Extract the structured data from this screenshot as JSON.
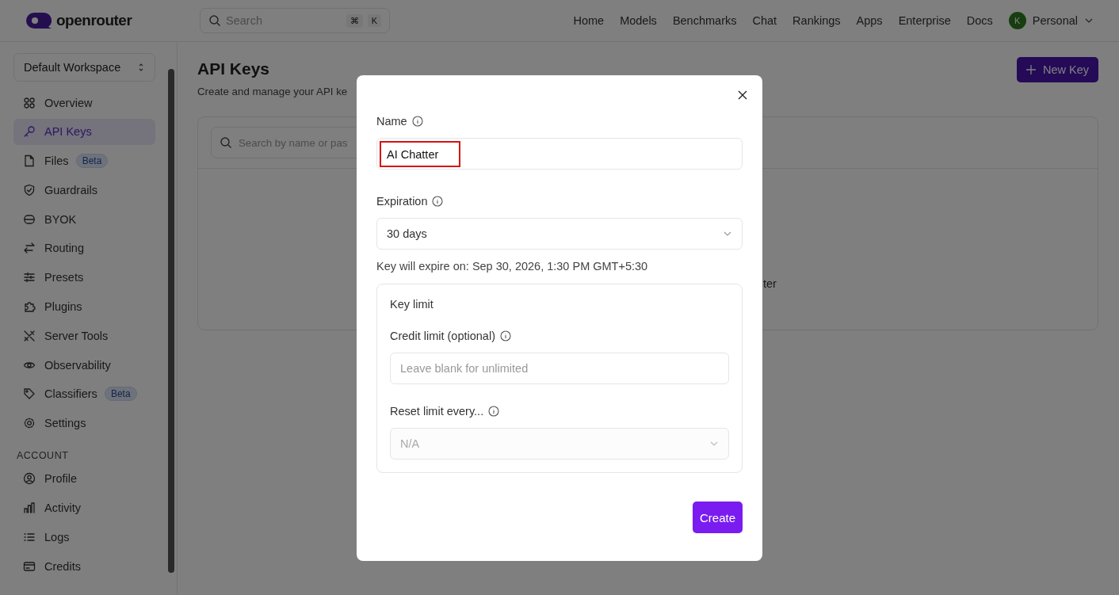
{
  "brand": {
    "name": "openrouter"
  },
  "search": {
    "placeholder": "Search",
    "shortcut": [
      "⌘",
      "K"
    ]
  },
  "nav": [
    "Home",
    "Models",
    "Benchmarks",
    "Chat",
    "Rankings",
    "Apps",
    "Enterprise",
    "Docs"
  ],
  "account": {
    "avatar": "K",
    "name": "Personal"
  },
  "workspace": {
    "name": "Default Workspace"
  },
  "sidebar": {
    "items": [
      {
        "label": "Overview",
        "selected": false
      },
      {
        "label": "API Keys",
        "selected": true
      },
      {
        "label": "Files",
        "selected": false,
        "badge": "Beta"
      },
      {
        "label": "Guardrails",
        "selected": false
      },
      {
        "label": "BYOK",
        "selected": false
      },
      {
        "label": "Routing",
        "selected": false
      },
      {
        "label": "Presets",
        "selected": false
      },
      {
        "label": "Plugins",
        "selected": false
      },
      {
        "label": "Server Tools",
        "selected": false
      },
      {
        "label": "Observability",
        "selected": false
      },
      {
        "label": "Classifiers",
        "selected": false,
        "badge": "Beta"
      },
      {
        "label": "Settings",
        "selected": false
      }
    ],
    "section_title": "ACCOUNT",
    "account_items": [
      {
        "label": "Profile",
        "selected": false
      },
      {
        "label": "Activity",
        "selected": false
      },
      {
        "label": "Logs",
        "selected": false
      },
      {
        "label": "Credits",
        "selected": false
      }
    ]
  },
  "page": {
    "title": "API Keys",
    "subtitle": "Create and manage your API ke",
    "new_key_button": "New Key",
    "search_placeholder": "Search by name or pas",
    "empty_text": "ter"
  },
  "modal": {
    "name_label": "Name",
    "name_value": "AI Chatter",
    "name_highlighted": true,
    "expiration_label": "Expiration",
    "expiration_value": "30 days",
    "expiry_note": "Key will expire on: Sep 30, 2026, 1:30 PM GMT+5:30",
    "key_limit": {
      "title": "Key limit",
      "credit_label": "Credit limit (optional)",
      "credit_placeholder": "Leave blank for unlimited",
      "reset_label": "Reset limit every...",
      "reset_value": "N/A",
      "reset_disabled": true
    },
    "create_button": "Create"
  }
}
